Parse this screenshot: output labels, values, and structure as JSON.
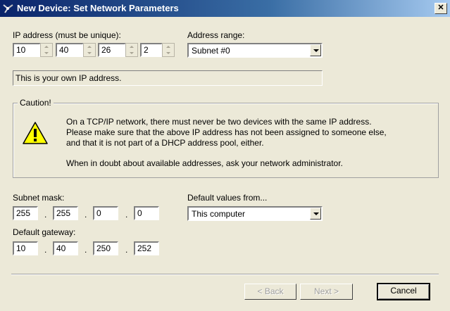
{
  "window": {
    "title": "New Device: Set Network Parameters",
    "close_glyph": "✕",
    "icon": "network-device-icon"
  },
  "ip": {
    "label": "IP address (must be unique):",
    "octets": [
      "10",
      "40",
      "26",
      "2"
    ],
    "status": "This is your own IP address."
  },
  "address_range": {
    "label": "Address range:",
    "selected": "Subnet #0"
  },
  "caution": {
    "legend": "Caution!",
    "icon": "warning-icon",
    "text1": "On a TCP/IP network, there must never be two devices with the same IP address.",
    "text2": "Please make sure that the above IP address has not been assigned to someone else,",
    "text3": "and that it is not part of a DHCP address pool, either.",
    "text4": "When in doubt about available addresses, ask your network administrator."
  },
  "subnet": {
    "label": "Subnet mask:",
    "octets": [
      "255",
      "255",
      "0",
      "0"
    ]
  },
  "defaults": {
    "label": "Default values from...",
    "selected": "This computer"
  },
  "gateway": {
    "label": "Default gateway:",
    "octets": [
      "10",
      "40",
      "250",
      "252"
    ]
  },
  "buttons": {
    "back": "< Back",
    "next": "Next >",
    "cancel": "Cancel"
  },
  "colors": {
    "title_bar": "#0a246a",
    "dialog_bg": "#ece9d8",
    "warning_yellow": "#ffff00"
  }
}
